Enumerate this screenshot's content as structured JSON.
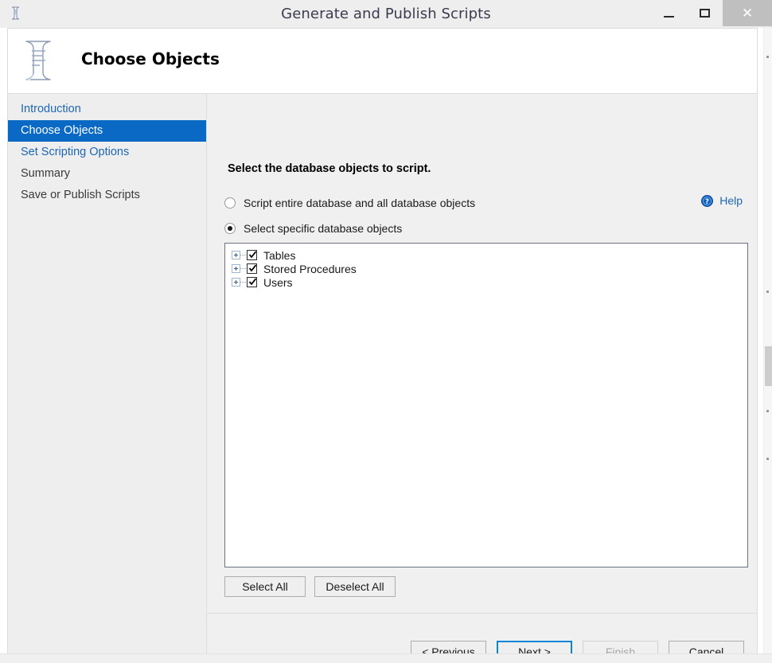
{
  "window": {
    "title": "Generate and Publish Scripts",
    "app_icon": "script-scroll-icon",
    "controls": {
      "minimize": "minimize-icon",
      "maximize": "maximize-icon",
      "close": "close-icon",
      "close_glyph": "✕"
    }
  },
  "banner": {
    "icon": "script-scroll-icon",
    "title": "Choose Objects"
  },
  "sidebar": {
    "items": [
      {
        "label": "Introduction",
        "state": "link"
      },
      {
        "label": "Choose Objects",
        "state": "active"
      },
      {
        "label": "Set Scripting Options",
        "state": "link"
      },
      {
        "label": "Summary",
        "state": "plain"
      },
      {
        "label": "Save or Publish Scripts",
        "state": "plain"
      }
    ]
  },
  "main": {
    "help": {
      "label": "Help",
      "icon": "help-question-icon"
    },
    "section_title": "Select the database objects to script.",
    "radios": [
      {
        "label": "Script entire database and all database objects",
        "checked": false
      },
      {
        "label": "Select specific database objects",
        "checked": true
      }
    ],
    "tree": {
      "nodes": [
        {
          "label": "Tables",
          "checked": true,
          "expandable": true
        },
        {
          "label": "Stored Procedures",
          "checked": true,
          "expandable": true
        },
        {
          "label": "Users",
          "checked": true,
          "expandable": true
        }
      ]
    },
    "select_buttons": [
      {
        "label": "Select All"
      },
      {
        "label": "Deselect All"
      }
    ]
  },
  "footer": {
    "buttons": [
      {
        "label": "< Previous",
        "state": "normal"
      },
      {
        "label": "Next >",
        "state": "focused"
      },
      {
        "label": "Finish",
        "state": "disabled"
      },
      {
        "label": "Cancel",
        "state": "normal"
      }
    ]
  },
  "colors": {
    "accent": "#0969c4",
    "link": "#1d66b3",
    "focus_border": "#0a84d8",
    "titlebar_bg": "#eeeeee",
    "panel_bg": "#f0f0f0",
    "close_hover_bg": "#bfbfbf"
  }
}
